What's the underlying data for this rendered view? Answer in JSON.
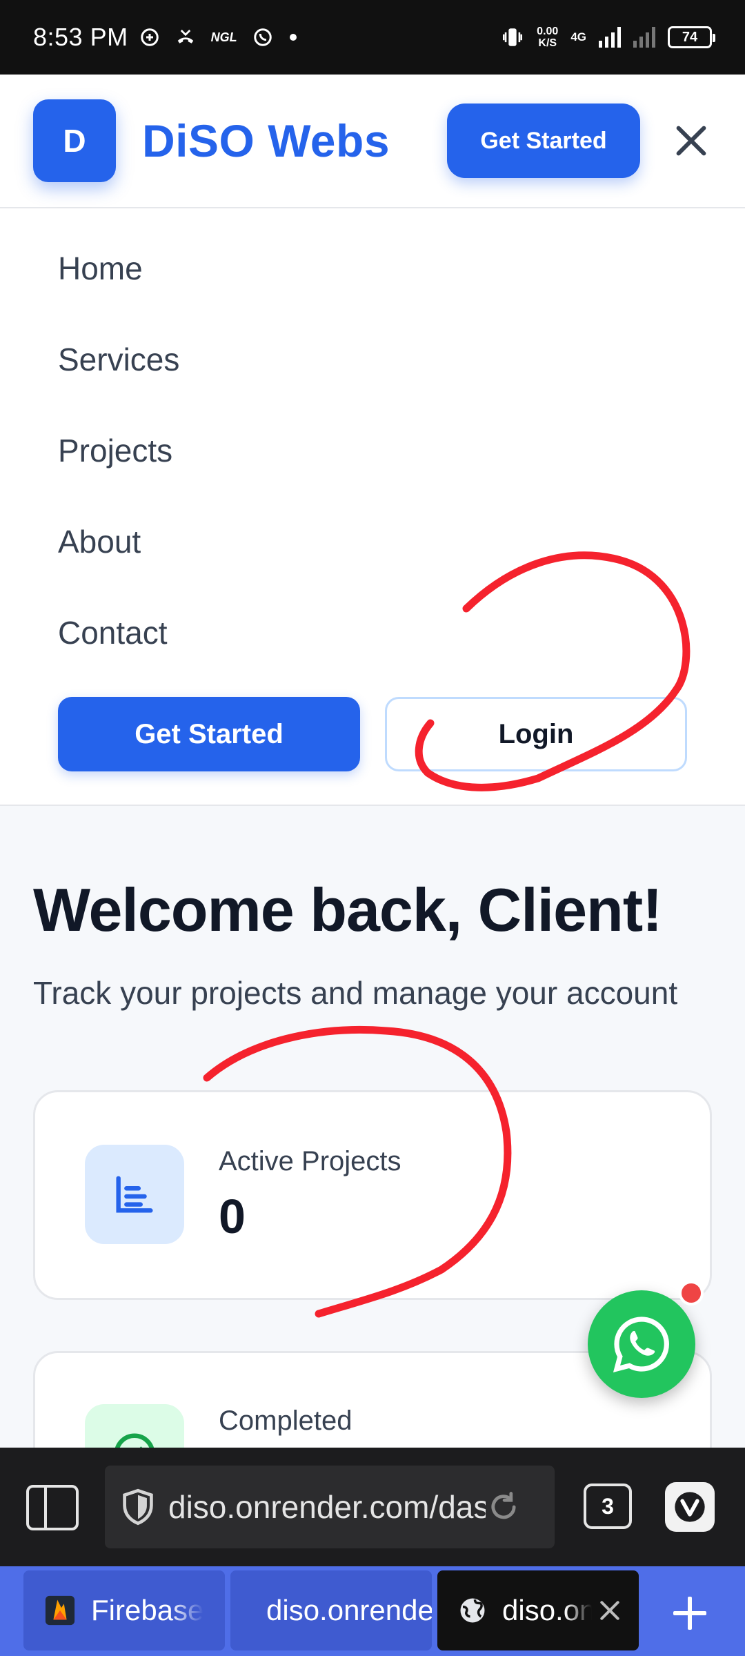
{
  "status_bar": {
    "time": "8:53 PM",
    "ngl_label": "NGL",
    "net_speed_value": "0.00",
    "net_speed_unit": "K/S",
    "net_type": "4G",
    "battery": "74"
  },
  "header": {
    "logo_letter": "D",
    "brand": "DiSO Webs",
    "cta_label": "Get Started"
  },
  "menu": {
    "items": [
      "Home",
      "Services",
      "Projects",
      "About",
      "Contact"
    ],
    "get_started_label": "Get Started",
    "login_label": "Login"
  },
  "main": {
    "title": "Welcome back, Client!",
    "subtitle": "Track your projects and manage your account",
    "cards": [
      {
        "label": "Active Projects",
        "value": "0"
      },
      {
        "label": "Completed",
        "value": ""
      }
    ]
  },
  "colors": {
    "primary": "#2563eb",
    "annotation": "#f5222d",
    "whatsapp": "#22c55e"
  },
  "browser": {
    "url": "diso.onrender.com/dashboard",
    "tab_count": "3",
    "tabs": [
      {
        "label": "Firebase",
        "icon": "firebase-icon",
        "active": false
      },
      {
        "label": "diso.onrender.com",
        "icon": "globe-icon",
        "active": false
      },
      {
        "label": "diso.onrender.com",
        "icon": "globe-icon",
        "active": true
      }
    ]
  }
}
